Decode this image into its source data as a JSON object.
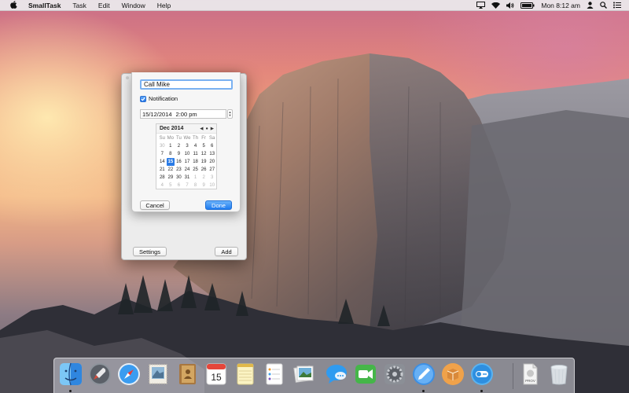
{
  "menubar": {
    "app_name": "SmallTask",
    "menus": [
      "Task",
      "Edit",
      "Window",
      "Help"
    ],
    "clock": "Mon 8:12 am"
  },
  "window": {
    "settings_label": "Settings",
    "add_label": "Add"
  },
  "popover": {
    "task_name": "Call Mike",
    "notification_label": "Notification",
    "notification_checked": true,
    "date": "15/12/2014",
    "time": "2:00 pm",
    "cancel_label": "Cancel",
    "done_label": "Done"
  },
  "calendar": {
    "month_label": "Dec 2014",
    "weekdays": [
      "Su",
      "Mo",
      "Tu",
      "We",
      "Th",
      "Fr",
      "Sa"
    ],
    "weeks": [
      [
        "30",
        "1",
        "2",
        "3",
        "4",
        "5",
        "6"
      ],
      [
        "7",
        "8",
        "9",
        "10",
        "11",
        "12",
        "13"
      ],
      [
        "14",
        "15",
        "16",
        "17",
        "18",
        "19",
        "20"
      ],
      [
        "21",
        "22",
        "23",
        "24",
        "25",
        "26",
        "27"
      ],
      [
        "28",
        "29",
        "30",
        "31",
        "1",
        "2",
        "3"
      ],
      [
        "4",
        "5",
        "6",
        "7",
        "8",
        "9",
        "10"
      ]
    ],
    "selected_day": "15"
  },
  "dock": {
    "calendar_day": "15",
    "preview_file_label": "PROV",
    "items": [
      {
        "name": "finder",
        "icon": "finder-icon",
        "running": true
      },
      {
        "name": "launchpad",
        "icon": "rocket-icon",
        "running": false
      },
      {
        "name": "safari",
        "icon": "compass-icon",
        "running": false
      },
      {
        "name": "mail",
        "icon": "stamp-icon",
        "running": false
      },
      {
        "name": "contacts",
        "icon": "address-book-icon",
        "running": false
      },
      {
        "name": "calendar",
        "icon": "calendar-icon",
        "running": false
      },
      {
        "name": "notes",
        "icon": "notes-icon",
        "running": false
      },
      {
        "name": "reminders",
        "icon": "checklist-icon",
        "running": false
      },
      {
        "name": "photos",
        "icon": "photos-icon",
        "running": false
      },
      {
        "name": "messages",
        "icon": "speech-bubble-icon",
        "running": false
      },
      {
        "name": "facetime",
        "icon": "video-camera-icon",
        "running": false
      },
      {
        "name": "system-preferences",
        "icon": "gear-icon",
        "running": false
      },
      {
        "name": "xcode-pencil",
        "icon": "pencil-icon",
        "running": true
      },
      {
        "name": "package",
        "icon": "box-icon",
        "running": false
      },
      {
        "name": "smalltask",
        "icon": "toggle-icon",
        "running": true
      },
      {
        "name": "provisioning-file",
        "icon": "document-icon",
        "running": false
      },
      {
        "name": "trash",
        "icon": "trash-icon",
        "running": false
      }
    ]
  }
}
